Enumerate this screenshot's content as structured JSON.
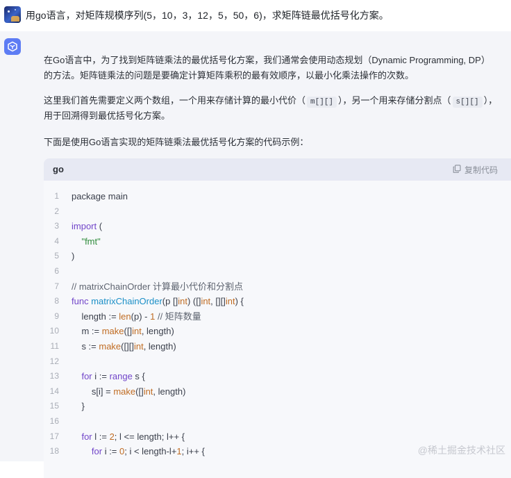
{
  "user": {
    "question": "用go语言，对矩阵规模序列(5，10，3，12，5，50，6)，求矩阵链最优括号化方案。"
  },
  "answer": {
    "para1_line1": "在Go语言中，为了找到矩阵链乘法的最优括号化方案，我们通常会使用动态规划（Dynamic Programming, DP）",
    "para1_line2": "的方法。矩阵链乘法的问题是要确定计算矩阵乘积的最有效顺序，以最小化乘法操作的次数。",
    "para2_line1_a": "这里我们首先需要定义两个数组，一个用来存储计算的最小代价（",
    "para2_code1": "m[][]",
    "para2_line1_b": "），另一个用来存储分割点（",
    "para2_code2": "s[][]",
    "para2_line1_c": "），",
    "para2_line2": "用于回溯得到最优括号化方案。",
    "para3": "下面是使用Go语言实现的矩阵链乘法最优括号化方案的代码示例："
  },
  "code_block": {
    "language": "go",
    "copy_label": "复制代码",
    "lines": [
      {
        "num": "1",
        "tokens": [
          {
            "t": "package main",
            "c": "plain"
          }
        ]
      },
      {
        "num": "2",
        "tokens": []
      },
      {
        "num": "3",
        "tokens": [
          {
            "t": "import",
            "c": "kw"
          },
          {
            "t": " (",
            "c": "plain"
          }
        ]
      },
      {
        "num": "4",
        "tokens": [
          {
            "t": "    ",
            "c": "plain"
          },
          {
            "t": "\"fmt\"",
            "c": "str"
          }
        ]
      },
      {
        "num": "5",
        "tokens": [
          {
            "t": ")",
            "c": "plain"
          }
        ]
      },
      {
        "num": "6",
        "tokens": []
      },
      {
        "num": "7",
        "tokens": [
          {
            "t": "// matrixChainOrder 计算最小代价和分割点",
            "c": "cm"
          }
        ]
      },
      {
        "num": "8",
        "tokens": [
          {
            "t": "func",
            "c": "kw"
          },
          {
            "t": " ",
            "c": "plain"
          },
          {
            "t": "matrixChainOrder",
            "c": "fn"
          },
          {
            "t": "(p []",
            "c": "plain"
          },
          {
            "t": "int",
            "c": "type"
          },
          {
            "t": ") ([]",
            "c": "plain"
          },
          {
            "t": "int",
            "c": "type"
          },
          {
            "t": ", [][]",
            "c": "plain"
          },
          {
            "t": "int",
            "c": "type"
          },
          {
            "t": ") {",
            "c": "plain"
          }
        ]
      },
      {
        "num": "9",
        "tokens": [
          {
            "t": "    length := ",
            "c": "plain"
          },
          {
            "t": "len",
            "c": "type"
          },
          {
            "t": "(p) - ",
            "c": "plain"
          },
          {
            "t": "1",
            "c": "num"
          },
          {
            "t": " // 矩阵数量",
            "c": "cm"
          }
        ]
      },
      {
        "num": "10",
        "tokens": [
          {
            "t": "    m := ",
            "c": "plain"
          },
          {
            "t": "make",
            "c": "type"
          },
          {
            "t": "([]",
            "c": "plain"
          },
          {
            "t": "int",
            "c": "type"
          },
          {
            "t": ", length)",
            "c": "plain"
          }
        ]
      },
      {
        "num": "11",
        "tokens": [
          {
            "t": "    s := ",
            "c": "plain"
          },
          {
            "t": "make",
            "c": "type"
          },
          {
            "t": "([][]",
            "c": "plain"
          },
          {
            "t": "int",
            "c": "type"
          },
          {
            "t": ", length)",
            "c": "plain"
          }
        ]
      },
      {
        "num": "12",
        "tokens": []
      },
      {
        "num": "13",
        "tokens": [
          {
            "t": "    ",
            "c": "plain"
          },
          {
            "t": "for",
            "c": "kw"
          },
          {
            "t": " i := ",
            "c": "plain"
          },
          {
            "t": "range",
            "c": "kw"
          },
          {
            "t": " s {",
            "c": "plain"
          }
        ]
      },
      {
        "num": "14",
        "tokens": [
          {
            "t": "        s[i] = ",
            "c": "plain"
          },
          {
            "t": "make",
            "c": "type"
          },
          {
            "t": "([]",
            "c": "plain"
          },
          {
            "t": "int",
            "c": "type"
          },
          {
            "t": ", length)",
            "c": "plain"
          }
        ]
      },
      {
        "num": "15",
        "tokens": [
          {
            "t": "    }",
            "c": "plain"
          }
        ]
      },
      {
        "num": "16",
        "tokens": []
      },
      {
        "num": "17",
        "tokens": [
          {
            "t": "    ",
            "c": "plain"
          },
          {
            "t": "for",
            "c": "kw"
          },
          {
            "t": " l := ",
            "c": "plain"
          },
          {
            "t": "2",
            "c": "num"
          },
          {
            "t": "; l <= length; l++ {",
            "c": "plain"
          }
        ]
      },
      {
        "num": "18",
        "tokens": [
          {
            "t": "        ",
            "c": "plain"
          },
          {
            "t": "for",
            "c": "kw"
          },
          {
            "t": " i := ",
            "c": "plain"
          },
          {
            "t": "0",
            "c": "num"
          },
          {
            "t": "; i < length-l+",
            "c": "plain"
          },
          {
            "t": "1",
            "c": "num"
          },
          {
            "t": "; i++ {",
            "c": "plain"
          }
        ]
      }
    ]
  },
  "watermark": "@稀土掘金技术社区",
  "icons": {
    "bot_avatar": "cube-logo-icon",
    "copy": "copy-icon"
  },
  "colors": {
    "keyword": "#7145c9",
    "function": "#1b8fc7",
    "type": "#c06c23",
    "string": "#2e8b3a",
    "bot_background": "#f4f5f9",
    "code_header": "#e7e9f3",
    "accent": "#5d7cf4"
  }
}
